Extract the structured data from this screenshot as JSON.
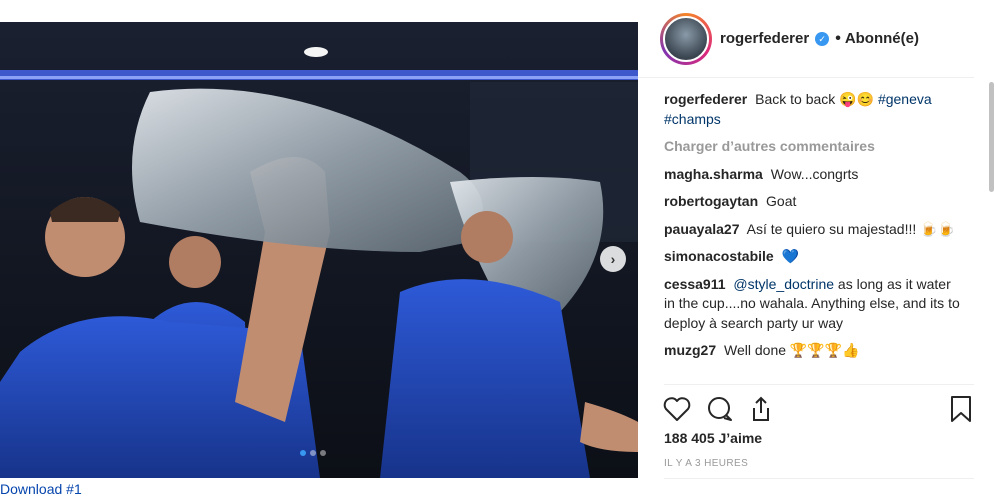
{
  "post": {
    "image_alt": "Player drinking from a large silver trophy in a locker room",
    "username": "rogerfederer",
    "separator": "•",
    "follow_label": "Abonné(e)",
    "caption": {
      "user": "rogerfederer",
      "text": "Back to back 😜😊",
      "hashtags": "#geneva #champs"
    },
    "load_more": "Charger d’autres commentaires",
    "comments": [
      {
        "user": "magha.sharma",
        "text": "Wow...congrts",
        "mention": ""
      },
      {
        "user": "robertogaytan",
        "text": "Goat",
        "mention": ""
      },
      {
        "user": "pauayala27",
        "text": "Así te quiero su majestad!!! 🍺🍺",
        "mention": ""
      },
      {
        "user": "simonacostabile",
        "text": "💙",
        "mention": ""
      },
      {
        "user": "cessa911",
        "mention": "@style_doctrine",
        "text": "as long as it water in the cup....no wahala. Anything else, and its to deploy à search party ur way"
      },
      {
        "user": "muzg27",
        "text": "Well done 🏆🏆🏆👍",
        "mention": ""
      }
    ],
    "likes": "188 405 J’aime",
    "timestamp": "IL Y A 3 HEURES",
    "carousel": {
      "count": 3,
      "active": 1
    }
  },
  "icons": {
    "verified": "verified-badge-icon",
    "next": "chevron-right-icon",
    "like": "heart-icon",
    "comment": "comment-bubble-icon",
    "share": "share-icon",
    "save": "bookmark-icon"
  },
  "colors": {
    "link": "#003569",
    "accent": "#3897f0",
    "muted": "#999999",
    "download_link": "#0645ad"
  },
  "download_link": "Download #1"
}
